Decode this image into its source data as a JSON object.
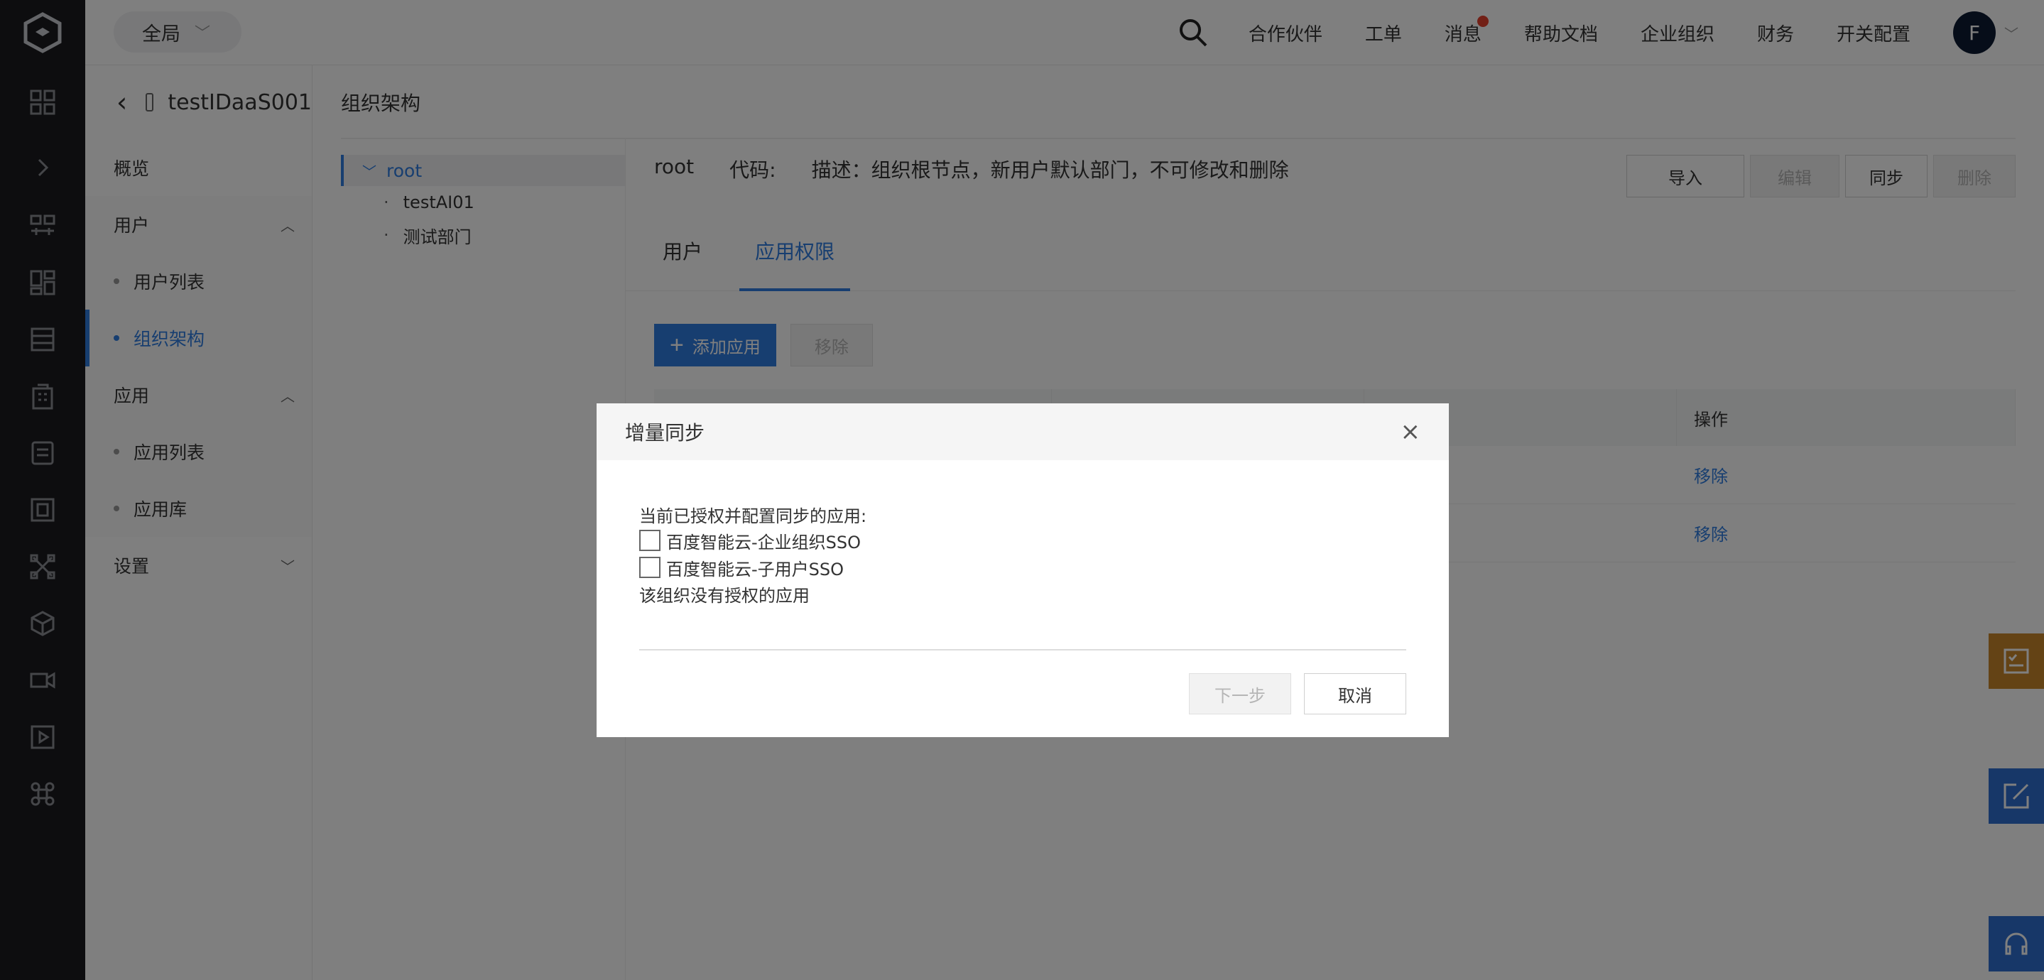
{
  "header": {
    "scope": "全局",
    "nav": [
      {
        "label": "合作伙伴"
      },
      {
        "label": "工单"
      },
      {
        "label": "消息",
        "badge": true
      },
      {
        "label": "帮助文档"
      },
      {
        "label": "企业组织"
      },
      {
        "label": "财务"
      },
      {
        "label": "开关配置"
      }
    ],
    "avatar": "F"
  },
  "sidebar": {
    "instance_name": "testIDaaS001",
    "overview": "概览",
    "users_group": "用户",
    "users_items": [
      "用户列表",
      "组织架构"
    ],
    "apps_group": "应用",
    "apps_items": [
      "应用列表",
      "应用库"
    ],
    "settings": "设置"
  },
  "main": {
    "title": "组织架构",
    "tree": {
      "root": "root",
      "children": [
        "testAI01",
        "测试部门"
      ]
    },
    "detail": {
      "name": "root",
      "code_label": "代码:",
      "desc": "描述：组织根节点，新用户默认部门，不可修改和删除",
      "buttons": {
        "import": "导入",
        "edit": "编辑",
        "sync": "同步",
        "delete": "删除"
      },
      "tabs": [
        "用户",
        "应用权限"
      ],
      "add_app": "添加应用",
      "remove": "移除",
      "table_header_op": "操作",
      "row_ops": [
        "移除",
        "移除"
      ]
    }
  },
  "dialog": {
    "title": "增量同步",
    "subtitle": "当前已授权并配置同步的应用:",
    "options": [
      "百度智能云-企业组织SSO",
      "百度智能云-子用户SSO"
    ],
    "empty_note": "该组织没有授权的应用",
    "next": "下一步",
    "cancel": "取消"
  },
  "colors": {
    "accent": "#2f7de1",
    "rail": "#1a1b1f",
    "float_orange": "#c8872a",
    "float_blue": "#2f6fd1"
  }
}
